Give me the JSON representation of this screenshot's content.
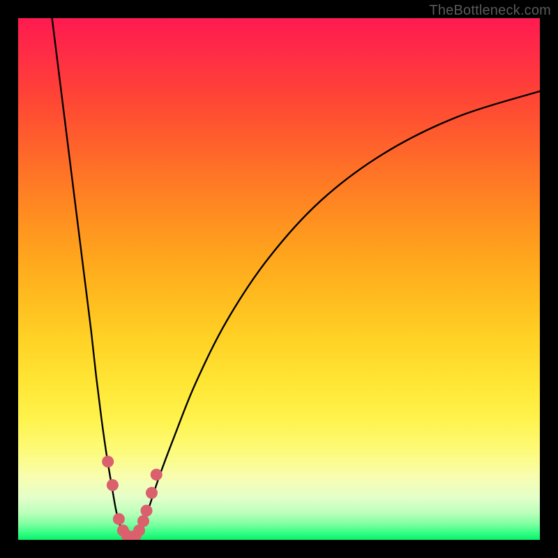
{
  "watermark": "TheBottleneck.com",
  "colors": {
    "curve": "#000000",
    "marker_fill": "#d9606c",
    "marker_stroke": "#b54651",
    "gradient_top": "#ff1a50",
    "gradient_bottom": "#08f26a"
  },
  "chart_data": {
    "type": "line",
    "title": "",
    "xlabel": "",
    "ylabel": "",
    "xlim": [
      0,
      100
    ],
    "ylim": [
      0,
      100
    ],
    "note": "Axes are unlabeled in the source image; x is an implicit horizontal parameter (0–100 left→right) and y is an implicit vertical percentage (0 at bottom green band, 100 at top red band). Values estimated from pixel positions.",
    "series": [
      {
        "name": "left-branch",
        "x": [
          6.5,
          8,
          9.5,
          11,
          12.5,
          14,
          15,
          16,
          17,
          18,
          18.7,
          19.3,
          20
        ],
        "y": [
          100,
          88,
          76,
          64,
          52,
          40,
          31,
          23,
          16,
          10,
          6,
          3.5,
          1.5
        ]
      },
      {
        "name": "valley",
        "x": [
          20,
          20.7,
          21.3,
          22,
          22.7,
          23.3
        ],
        "y": [
          1.5,
          0.6,
          0.3,
          0.3,
          0.6,
          1.5
        ]
      },
      {
        "name": "right-branch",
        "x": [
          23.3,
          25,
          27,
          30,
          34,
          40,
          48,
          58,
          70,
          84,
          100
        ],
        "y": [
          1.5,
          6,
          12,
          20,
          30,
          42,
          54,
          65,
          74,
          81,
          86
        ]
      }
    ],
    "markers": {
      "name": "highlighted-points",
      "x": [
        17.2,
        18.1,
        19.3,
        20.1,
        20.9,
        21.7,
        22.5,
        23.2,
        24.0,
        24.6,
        25.6,
        26.5
      ],
      "y": [
        15.0,
        10.5,
        4.0,
        1.8,
        0.8,
        0.5,
        0.8,
        1.8,
        3.6,
        5.6,
        9.0,
        12.5
      ]
    }
  }
}
